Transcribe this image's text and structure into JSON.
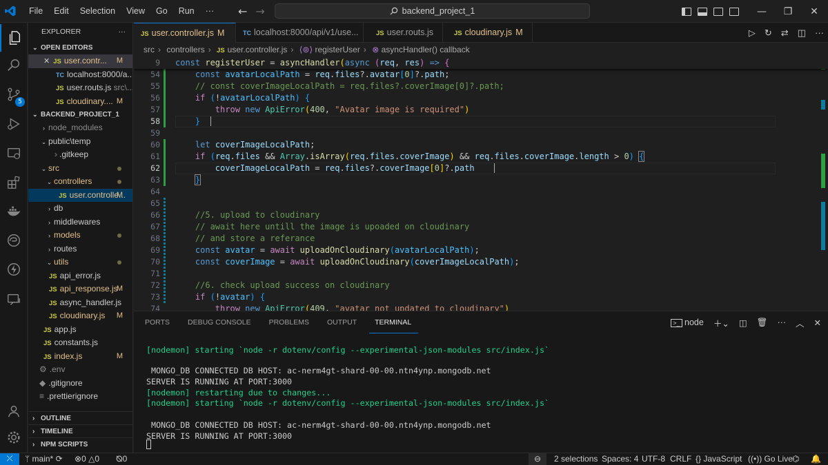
{
  "titlebar": {
    "menu": [
      "File",
      "Edit",
      "Selection",
      "View",
      "Go",
      "Run",
      "···"
    ],
    "search": "backend_project_1"
  },
  "activity": {
    "scm_badge": "5"
  },
  "sidebar": {
    "header": "EXPLORER",
    "open_editors_title": "OPEN EDITORS",
    "open_editors": [
      {
        "icon": "JS",
        "label": "user.contr...",
        "mark": "M",
        "close": "✕"
      },
      {
        "icon": "TC",
        "label": "localhost:8000/a..."
      },
      {
        "icon": "JS",
        "label": "user.routs.js",
        "desc": "src\\..."
      },
      {
        "icon": "JS",
        "label": "cloudinary....",
        "mark": "M"
      }
    ],
    "project_title": "BACKEND_PROJECT_1",
    "tree": [
      {
        "label": "node_modules",
        "type": "folder-closed",
        "depth": 1
      },
      {
        "label": "public\\temp",
        "type": "folder-open",
        "depth": 1
      },
      {
        "label": ".gitkeep",
        "type": "file",
        "depth": 2
      },
      {
        "label": "src",
        "type": "folder-open",
        "depth": 1
      },
      {
        "label": "controllers",
        "type": "folder-open",
        "depth": 2
      },
      {
        "label": "user.controlle...",
        "type": "js",
        "depth": 3,
        "mark": "M"
      },
      {
        "label": "db",
        "type": "folder-closed",
        "depth": 2
      },
      {
        "label": "middlewares",
        "type": "folder-closed",
        "depth": 2
      },
      {
        "label": "models",
        "type": "folder-closed",
        "depth": 2
      },
      {
        "label": "routes",
        "type": "folder-closed",
        "depth": 2
      },
      {
        "label": "utils",
        "type": "folder-open",
        "depth": 2
      },
      {
        "label": "api_error.js",
        "type": "js",
        "depth": 3
      },
      {
        "label": "api_response.js",
        "type": "js",
        "depth": 3,
        "mark": "M"
      },
      {
        "label": "async_handler.js",
        "type": "js",
        "depth": 3
      },
      {
        "label": "cloudinary.js",
        "type": "js",
        "depth": 3,
        "mark": "M"
      },
      {
        "label": "app.js",
        "type": "js",
        "depth": 2
      },
      {
        "label": "constants.js",
        "type": "js",
        "depth": 2
      },
      {
        "label": "index.js",
        "type": "js",
        "depth": 2,
        "mark": "M"
      },
      {
        "label": ".env",
        "type": "file",
        "depth": 1
      },
      {
        "label": ".gitignore",
        "type": "file",
        "depth": 1
      },
      {
        "label": ".prettierignore",
        "type": "file",
        "depth": 1
      }
    ],
    "outline": "OUTLINE",
    "timeline": "TIMELINE",
    "npm_scripts": "NPM SCRIPTS"
  },
  "tabs": [
    {
      "icon": "JS",
      "label": "user.controller.js",
      "mark": "M",
      "active": true
    },
    {
      "icon": "TC",
      "label": "localhost:8000/api/v1/use..."
    },
    {
      "icon": "JS",
      "label": "user.routs.js"
    },
    {
      "icon": "JS",
      "label": "cloudinary.js",
      "mark": "M"
    }
  ],
  "breadcrumb": [
    "src",
    "controllers",
    "user.controller.js",
    "registerUser",
    "asyncHandler() callback"
  ],
  "editor": {
    "lines": [
      {
        "n": "9",
        "sticky": true
      },
      {
        "n": "54"
      },
      {
        "n": "55"
      },
      {
        "n": "56"
      },
      {
        "n": "57"
      },
      {
        "n": "58"
      },
      {
        "n": "59"
      },
      {
        "n": "60"
      },
      {
        "n": "61"
      },
      {
        "n": "62"
      },
      {
        "n": "63"
      },
      {
        "n": "64"
      },
      {
        "n": "65"
      },
      {
        "n": "66"
      },
      {
        "n": "67"
      },
      {
        "n": "68"
      },
      {
        "n": "69"
      },
      {
        "n": "70"
      },
      {
        "n": "71"
      },
      {
        "n": "72"
      },
      {
        "n": "73"
      },
      {
        "n": "74"
      }
    ]
  },
  "panel": {
    "tabs": [
      "PORTS",
      "DEBUG CONSOLE",
      "PROBLEMS",
      "OUTPUT",
      "TERMINAL"
    ],
    "active_tab": "TERMINAL",
    "terminal_name": "node",
    "terminal": [
      {
        "text": "[nodemon] starting `node -r dotenv/config --experimental-json-modules src/index.js`",
        "color": "green"
      },
      {
        "text": ""
      },
      {
        "text": " MONGO_DB CONNECTED DB HOST: ac-nerm4gt-shard-00-00.ntn4ynp.mongodb.net",
        "color": "white"
      },
      {
        "text": "SERVER IS RUNNING AT PORT:3000",
        "color": "white"
      },
      {
        "text": "[nodemon] restarting due to changes...",
        "color": "green"
      },
      {
        "text": "[nodemon] starting `node -r dotenv/config --experimental-json-modules src/index.js`",
        "color": "green"
      },
      {
        "text": ""
      },
      {
        "text": " MONGO_DB CONNECTED DB HOST: ac-nerm4gt-shard-00-00.ntn4ynp.mongodb.net",
        "color": "white"
      },
      {
        "text": "SERVER IS RUNNING AT PORT:3000",
        "color": "white"
      }
    ]
  },
  "statusbar": {
    "branch": "main*",
    "errors": "0",
    "warnings": "0",
    "ports": "0",
    "selections": "2 selections",
    "spaces": "Spaces: 4",
    "encoding": "UTF-8",
    "eol": "CRLF",
    "language": "JavaScript",
    "golive": "Go Live"
  }
}
